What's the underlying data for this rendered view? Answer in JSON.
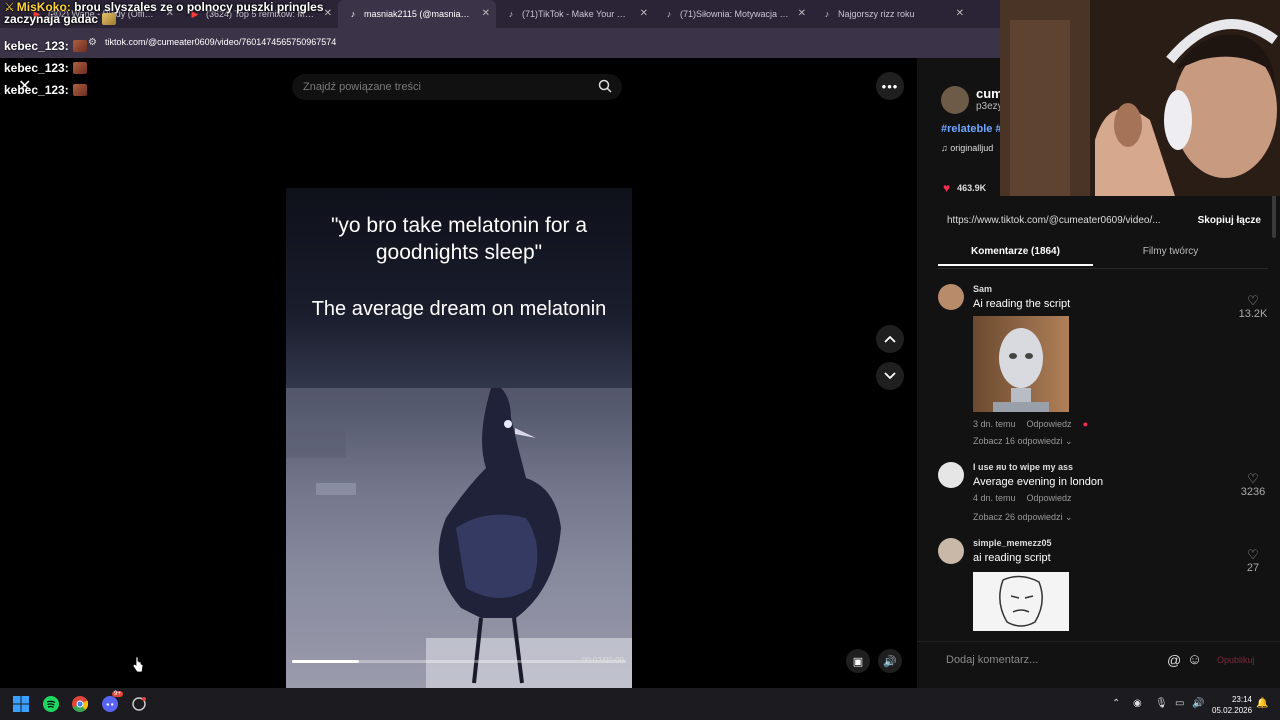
{
  "browser": {
    "tabs": [
      {
        "title": "(302) Wane - Bledy (Official M...",
        "icon": "youtube-icon",
        "active": false
      },
      {
        "title": "(3624) Top 5 remixow: Medusa",
        "icon": "youtube-icon",
        "active": false
      },
      {
        "title": "masniak2115 (@masniak2...",
        "icon": "tiktok-icon",
        "active": true
      },
      {
        "title": "(71)TikTok - Make Your Day",
        "icon": "tiktok-icon",
        "active": false
      },
      {
        "title": "(71)Siłownia: Motywacja do Dz...",
        "icon": "tiktok-icon",
        "active": false
      },
      {
        "title": "Najgorszy rizz roku",
        "icon": "tiktok-icon",
        "active": false
      }
    ],
    "url": "tiktok.com/@cumeater0609/video/7601474565750967574"
  },
  "chat": {
    "line1_name": "MisKoko:",
    "line1_text": "brou slyszales ze o polnocy puszki pringles",
    "line2_text": "zaczynaja gadac",
    "kebec": [
      "kebec_123:",
      "kebec_123:",
      "kebec_123:"
    ]
  },
  "tiktok": {
    "search_placeholder": "Znajdź powiązane treści",
    "caption_top": "\"yo bro take melatonin for a goodnights sleep\"",
    "caption_bottom": "The average dream on melatonin",
    "video_time": "00:02/00:09",
    "progress_fraction": 0.2,
    "creator": {
      "username": "cum",
      "sub": "p3ezy",
      "tags": "#relateble #",
      "sound": "♫ originalljud"
    },
    "likes": "463.9K",
    "link": "https://www.tiktok.com/@cumeater0609/video/...",
    "copy_link": "Skopiuj łącze",
    "tab_comments": "Komentarze (1864)",
    "tab_creator_videos": "Filmy twórcy",
    "comments": [
      {
        "name": "Sam",
        "text": "Ai reading the script",
        "likes": "13.2K",
        "time": "3 dn. temu",
        "reply": "Odpowiedz",
        "view_replies": "Zobacz 16 odpowiedzi ⌄"
      },
      {
        "name": "I use ᴙᴜ to wipe my ass",
        "text": "Average evening in london",
        "likes": "3236",
        "time": "4 dn. temu",
        "reply": "Odpowiedz",
        "view_replies": "Zobacz 26 odpowiedzi ⌄"
      },
      {
        "name": "simple_memezz05",
        "text": "ai reading script",
        "likes": "27"
      }
    ],
    "add_comment_placeholder": "Dodaj komentarz...",
    "post_label": "Opublikuj"
  },
  "taskbar": {
    "time": "23:14",
    "date": "05.02.2026",
    "discord_badge": "9+"
  },
  "colors": {
    "tiktok_red": "#fe2c55",
    "hashtag_blue": "#6fa5ff",
    "chat_name_yellow": "#ffd43b"
  }
}
